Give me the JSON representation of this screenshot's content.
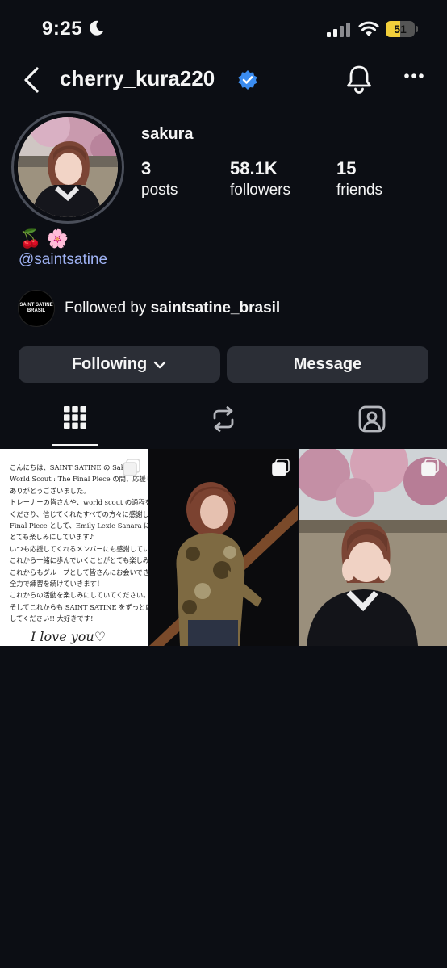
{
  "status_bar": {
    "time": "9:25",
    "battery_level": "51",
    "icons": [
      "moon-icon",
      "cellular-signal-icon",
      "wifi-icon",
      "battery-icon"
    ]
  },
  "header": {
    "username": "cherry_kura220",
    "icons": [
      "back-chevron-icon",
      "verified-badge-icon",
      "bell-icon",
      "more-options-icon"
    ]
  },
  "profile": {
    "display_name": "sakura",
    "stats": [
      {
        "value": "3",
        "label": "posts"
      },
      {
        "value": "58.1K",
        "label": "followers"
      },
      {
        "value": "15",
        "label": "friends"
      }
    ],
    "bio_emoji": "🍒 🌸",
    "bio_link": "@saintsatine"
  },
  "followed_by": {
    "avatar_text_line1": "SAINT SATINE",
    "avatar_text_line2": "BRASIL",
    "prefix": "Followed by ",
    "account": "saintsatine_brasil"
  },
  "actions": {
    "following_label": "Following",
    "message_label": "Message"
  },
  "tabs": [
    {
      "icon": "grid-icon",
      "active": true
    },
    {
      "icon": "reposts-icon",
      "active": false
    },
    {
      "icon": "tagged-icon",
      "active": false
    }
  ],
  "posts": {
    "letter_lines": [
      "こんにちは、SAINT SATINE の Sakura",
      "World Scout : The Final Piece の間、応援してくださ",
      "ありがとうございました。",
      "トレーナーの皆さんや、world scout の過程を助けて",
      "くださり、信じてくれたすべての方々に感謝しています。",
      "Final Piece として、Emily Lexie Sanara に参加できるのを",
      "とても楽しみにしています♪",
      "いつも応援してくれるメンバーにも感謝していますし、",
      "これから一緒に歩んでいくことがとても楽しみです。",
      "これからもグループとして皆さんにお会いできる日まで、",
      "全力で練習を続けていきます！",
      "これからの活動を楽しみにしていてください。",
      "そしてこれからも SAINT SATINE をずっと応援",
      "してください!! 大好きです!"
    ],
    "letter_signoff": "I love you♡",
    "items": [
      {
        "type": "letter",
        "multi": true
      },
      {
        "type": "photo",
        "multi": true
      },
      {
        "type": "photo",
        "multi": true
      }
    ]
  }
}
